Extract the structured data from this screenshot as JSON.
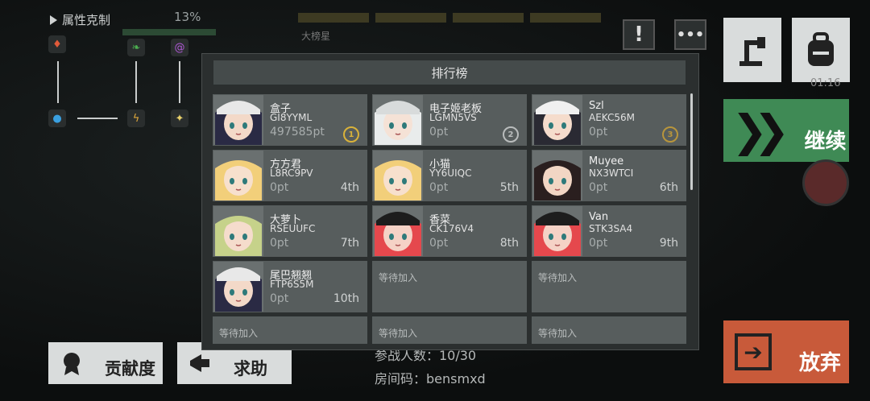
{
  "hud": {
    "attr_title": "属性克制",
    "attr_pct": "13%",
    "topbar_label": "大榜星"
  },
  "modal": {
    "title": "排行榜"
  },
  "players": [
    {
      "name": "盒子",
      "code": "GI8YYML",
      "pts": "497585pt",
      "rank": "",
      "medal": "1",
      "medal_color": "#d9b23a",
      "hair": "#2a2a44",
      "hat": "#e8e8e8",
      "skin": "#f3d9c8"
    },
    {
      "name": "电子姬老板",
      "code": "LGMN5VS",
      "pts": "0pt",
      "rank": "",
      "medal": "2",
      "medal_color": "#b9bcbc",
      "hair": "#e9ecec",
      "hat": "#d8dbdb",
      "skin": "#f5e2d6"
    },
    {
      "name": "Szl",
      "code": "AEKC56M",
      "pts": "0pt",
      "rank": "",
      "medal": "3",
      "medal_color": "#b8953c",
      "hair": "#2a2a33",
      "hat": "#f0f0f0",
      "skin": "#f5dccc"
    },
    {
      "name": "方方君",
      "code": "L8RC9PV",
      "pts": "0pt",
      "rank": "4th",
      "medal": "",
      "medal_color": "",
      "hair": "#f2cf7a",
      "hat": "",
      "skin": "#f7e0cd"
    },
    {
      "name": "小猫",
      "code": "YY6UIQC",
      "pts": "0pt",
      "rank": "5th",
      "medal": "",
      "medal_color": "",
      "hair": "#f2cf7a",
      "hat": "",
      "skin": "#f7e0cd"
    },
    {
      "name": "Muyee",
      "code": "NX3WTCI",
      "pts": "0pt",
      "rank": "6th",
      "medal": "",
      "medal_color": "",
      "hair": "#2a1f1f",
      "hat": "",
      "skin": "#f2d6c4"
    },
    {
      "name": "大萝卜",
      "code": "RSEUUFC",
      "pts": "0pt",
      "rank": "7th",
      "medal": "",
      "medal_color": "",
      "hair": "#c6d28a",
      "hat": "",
      "skin": "#f5dccc"
    },
    {
      "name": "香菜",
      "code": "CK176V4",
      "pts": "0pt",
      "rank": "8th",
      "medal": "",
      "medal_color": "",
      "hair": "#e5484d",
      "hat": "#1d1d1d",
      "skin": "#f5d2c6"
    },
    {
      "name": "Van",
      "code": "STK3SA4",
      "pts": "0pt",
      "rank": "9th",
      "medal": "",
      "medal_color": "",
      "hair": "#e5484d",
      "hat": "#1d1d1d",
      "skin": "#f5d2c6"
    },
    {
      "name": "尾巴翘翘",
      "code": "FTP6S5M",
      "pts": "0pt",
      "rank": "10th",
      "medal": "",
      "medal_color": "",
      "hair": "#2a2a44",
      "hat": "#e8e8e8",
      "skin": "#f3d9c8"
    }
  ],
  "waiting_label": "等待加入",
  "buttons": {
    "continue": "继续",
    "giveup": "放弃",
    "contribution": "贡献度",
    "help": "求助"
  },
  "bottom": {
    "participants": "参战人数：10/30",
    "room": "房间码：bensmxd"
  },
  "misc": {
    "time": "01:16"
  }
}
